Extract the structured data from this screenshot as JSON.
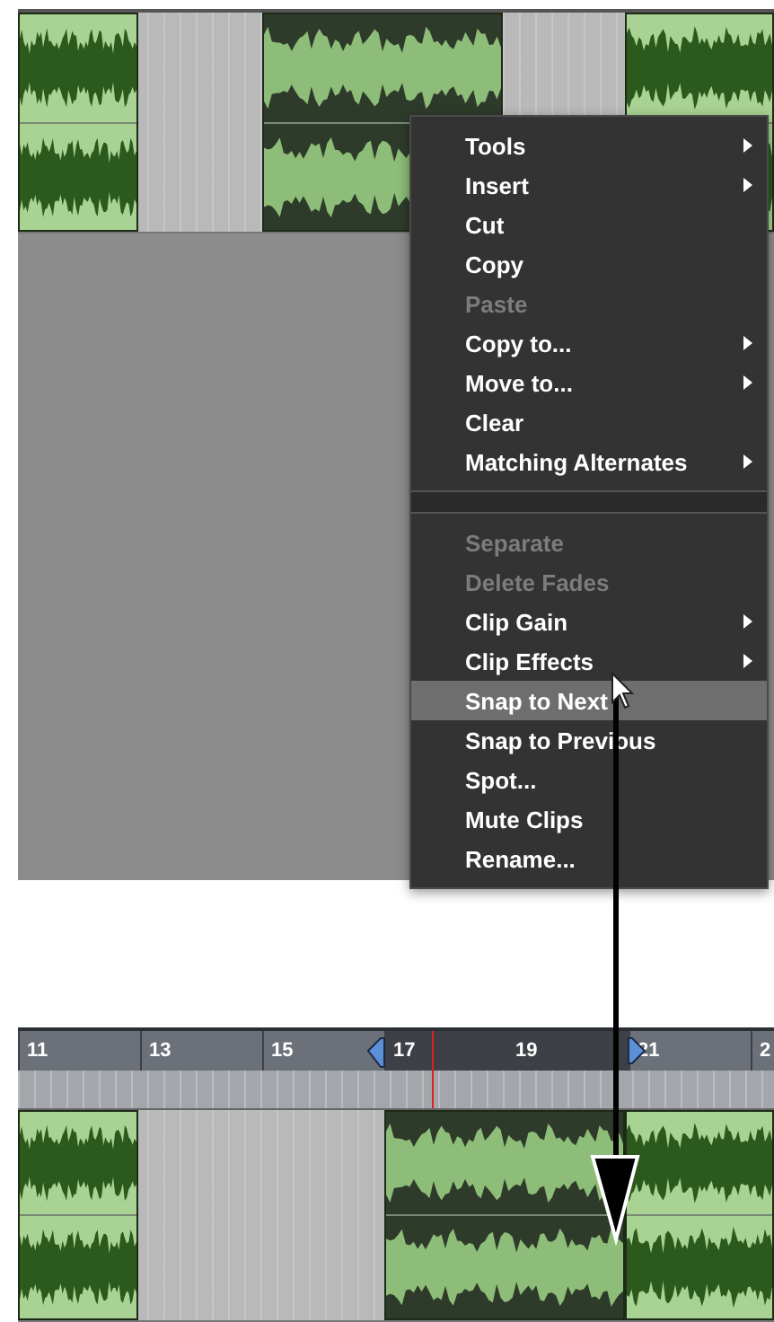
{
  "top_view": {
    "clips": [
      {
        "selected": false
      },
      {
        "selected": true
      },
      {
        "selected": false
      }
    ]
  },
  "context_menu": {
    "sections": [
      {
        "items": [
          {
            "label": "Tools",
            "submenu": true,
            "disabled": false,
            "selected": false
          },
          {
            "label": "Insert",
            "submenu": true,
            "disabled": false,
            "selected": false
          },
          {
            "label": "Cut",
            "submenu": false,
            "disabled": false,
            "selected": false
          },
          {
            "label": "Copy",
            "submenu": false,
            "disabled": false,
            "selected": false
          },
          {
            "label": "Paste",
            "submenu": false,
            "disabled": true,
            "selected": false
          },
          {
            "label": "Copy to...",
            "submenu": true,
            "disabled": false,
            "selected": false
          },
          {
            "label": "Move to...",
            "submenu": true,
            "disabled": false,
            "selected": false
          },
          {
            "label": "Clear",
            "submenu": false,
            "disabled": false,
            "selected": false
          },
          {
            "label": "Matching Alternates",
            "submenu": true,
            "disabled": false,
            "selected": false
          }
        ]
      },
      {
        "items": [
          {
            "label": "Separate",
            "submenu": false,
            "disabled": true,
            "selected": false
          },
          {
            "label": "Delete Fades",
            "submenu": false,
            "disabled": true,
            "selected": false
          },
          {
            "label": "Clip Gain",
            "submenu": true,
            "disabled": false,
            "selected": false
          },
          {
            "label": "Clip Effects",
            "submenu": true,
            "disabled": false,
            "selected": false
          },
          {
            "label": "Snap to Next",
            "submenu": false,
            "disabled": false,
            "selected": true
          },
          {
            "label": "Snap to Previous",
            "submenu": false,
            "disabled": false,
            "selected": false
          },
          {
            "label": "Spot...",
            "submenu": false,
            "disabled": false,
            "selected": false
          },
          {
            "label": "Mute Clips",
            "submenu": false,
            "disabled": false,
            "selected": false
          },
          {
            "label": "Rename...",
            "submenu": false,
            "disabled": false,
            "selected": false
          }
        ]
      }
    ]
  },
  "bottom_view": {
    "ruler": [
      {
        "label": "11",
        "selected": false
      },
      {
        "label": "13",
        "selected": false
      },
      {
        "label": "15",
        "selected": false
      },
      {
        "label": "17",
        "selected": true
      },
      {
        "label": "19",
        "selected": true
      },
      {
        "label": "21",
        "selected": false
      },
      {
        "label": "2",
        "selected": false
      }
    ],
    "clips": [
      {
        "selected": false
      },
      {
        "selected": true
      },
      {
        "selected": false
      }
    ]
  }
}
